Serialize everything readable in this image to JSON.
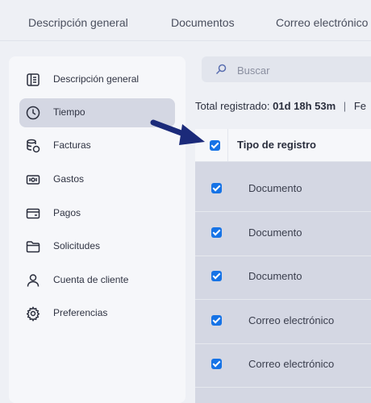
{
  "top_tabs": [
    {
      "label": "Descripción general"
    },
    {
      "label": "Documentos"
    },
    {
      "label": "Correo electrónico"
    }
  ],
  "sidebar": {
    "items": [
      {
        "label": "Descripción general",
        "icon": "overview-icon"
      },
      {
        "label": "Tiempo",
        "icon": "clock-icon",
        "active": true
      },
      {
        "label": "Facturas",
        "icon": "invoice-icon"
      },
      {
        "label": "Gastos",
        "icon": "money-icon"
      },
      {
        "label": "Pagos",
        "icon": "card-icon"
      },
      {
        "label": "Solicitudes",
        "icon": "folder-icon"
      },
      {
        "label": "Cuenta de cliente",
        "icon": "user-icon"
      },
      {
        "label": "Preferencias",
        "icon": "gear-icon"
      }
    ]
  },
  "search": {
    "placeholder": "Buscar"
  },
  "summary": {
    "label": "Total registrado:",
    "value": "01d 18h 53m",
    "separator": "|",
    "next": "Fe"
  },
  "table": {
    "header": "Tipo de registro",
    "header_checked": true,
    "rows": [
      {
        "type": "Documento",
        "checked": true
      },
      {
        "type": "Documento",
        "checked": true
      },
      {
        "type": "Documento",
        "checked": true
      },
      {
        "type": "Correo electrónico",
        "checked": true
      },
      {
        "type": "Correo electrónico",
        "checked": true
      }
    ]
  },
  "colors": {
    "accent": "#1673e6",
    "arrow": "#1b2a7a",
    "selected_row": "#d4d7e3"
  }
}
